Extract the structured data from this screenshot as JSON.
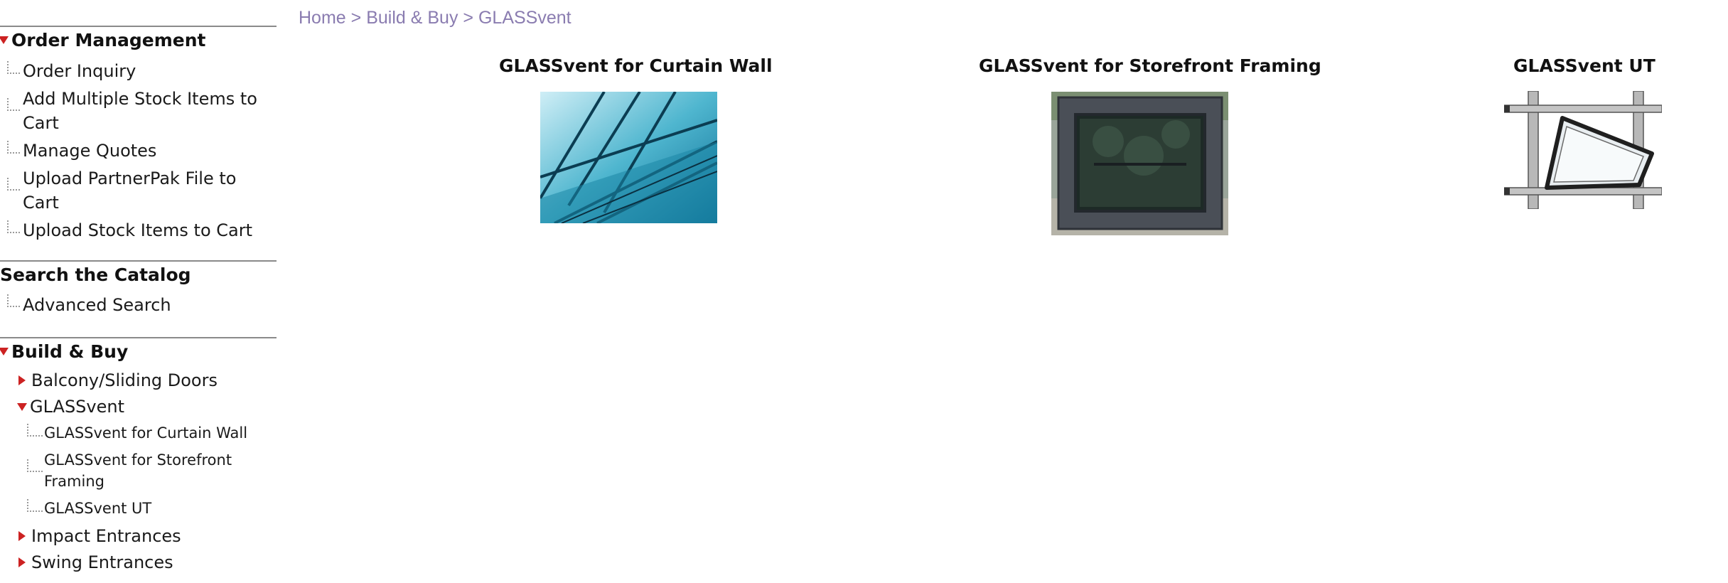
{
  "breadcrumb": {
    "home": "Home",
    "sep1": ">",
    "build_buy": "Build & Buy",
    "sep2": ">",
    "current": "GLASSvent"
  },
  "sidebar": {
    "order_management": {
      "title": "Order Management",
      "items": [
        "Order Inquiry",
        "Add Multiple Stock Items to Cart",
        "Manage Quotes",
        "Upload PartnerPak File to Cart",
        "Upload Stock Items to Cart"
      ],
      "item2_line1": "Add Multiple Stock Items to",
      "item2_line2": "Cart",
      "item4_line1": "Upload PartnerPak File to",
      "item4_line2": "Cart"
    },
    "search": {
      "title": "Search the Catalog",
      "items": [
        "Advanced Search"
      ]
    },
    "build_buy": {
      "title": "Build & Buy",
      "items": {
        "balcony": "Balcony/Sliding Doors",
        "glassvent": "GLASSvent",
        "glassvent_children": {
          "curtain_wall": "GLASSvent for Curtain Wall",
          "storefront_line1": "GLASSvent for Storefront",
          "storefront_line2": "Framing",
          "ut": "GLASSvent UT"
        },
        "impact": "Impact Entrances",
        "swing": "Swing Entrances"
      }
    }
  },
  "products": [
    {
      "title": "GLASSvent for Curtain Wall",
      "image": "curtain-wall-photo"
    },
    {
      "title": "GLASSvent for Storefront Framing",
      "image": "storefront-framing-photo"
    },
    {
      "title": "GLASSvent UT",
      "image": "ut-window-render"
    }
  ],
  "colors": {
    "accent_triangle": "#cc2222",
    "breadcrumb": "#8a7cb0",
    "divider": "#8a8a8a"
  }
}
